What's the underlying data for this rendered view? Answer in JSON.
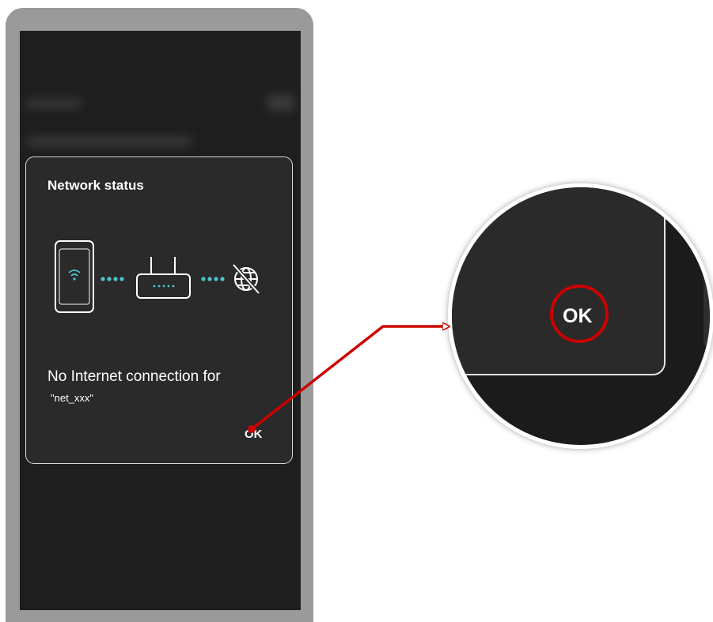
{
  "dialog": {
    "title": "Network status",
    "message": "No Internet connection for",
    "ssid": "\"net_xxx\"",
    "ok_label": "OK"
  },
  "magnifier": {
    "ok_label": "OK"
  },
  "colors": {
    "screen_bg": "#1e1e1e",
    "dialog_bg": "#2a2a2a",
    "frame": "#9a9a9a",
    "accent_teal": "#4fc3d0",
    "highlight_red": "#cc0000"
  },
  "icons": {
    "phone": "smartphone-wifi-icon",
    "router": "router-icon",
    "globe": "no-internet-globe-icon"
  }
}
